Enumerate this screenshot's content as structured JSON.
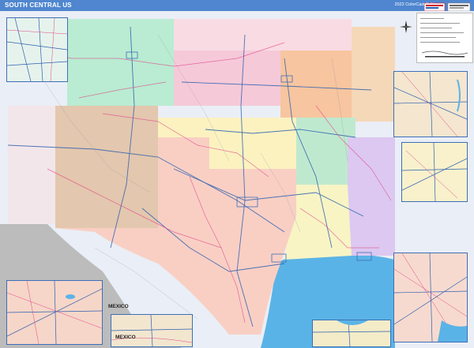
{
  "header": {
    "title": "SOUTH CENTRAL US",
    "edition": "2022 ColorCast Edition"
  },
  "labels": {
    "mexico_main": "MEXICO",
    "mexico_inset": "MEXICO"
  },
  "colors": {
    "header": "#4f86cf",
    "ocean": "#5ab3e6",
    "mexico": "#bcbcbc",
    "border": "#3d6fb8",
    "roads_interstate": "#2d5fb0",
    "roads_highway": "#e0458a"
  },
  "icons": {
    "compass": "compass-rose-icon",
    "brand": "brand-logo"
  }
}
